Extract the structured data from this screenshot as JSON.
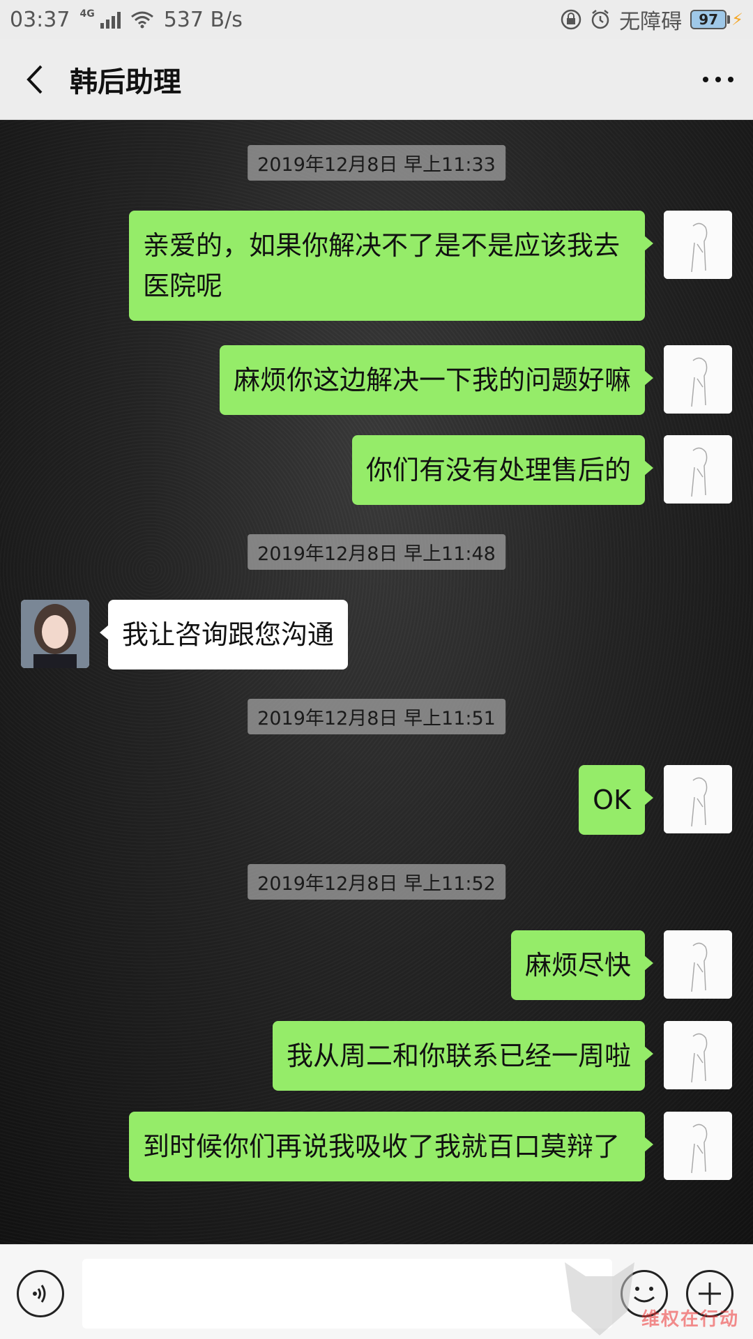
{
  "status_bar": {
    "time": "03:37",
    "network": "4G",
    "speed": "537 B/s",
    "accessibility": "无障碍",
    "battery": "97",
    "icons": [
      "signal-icon",
      "wifi-icon",
      "lock-icon",
      "alarm-icon",
      "battery-icon",
      "charging-icon"
    ]
  },
  "header": {
    "title": "韩后助理",
    "back_icon": "chevron-left-icon",
    "more_icon": "more-dots-icon"
  },
  "messages": [
    {
      "type": "timestamp",
      "text": "2019年12月8日 早上11:33"
    },
    {
      "type": "out",
      "text": "亲爱的，如果你解决不了是不是应该我去医院呢"
    },
    {
      "type": "out",
      "text": "麻烦你这边解决一下我的问题好嘛"
    },
    {
      "type": "out",
      "text": "你们有没有处理售后的"
    },
    {
      "type": "timestamp",
      "text": "2019年12月8日 早上11:48"
    },
    {
      "type": "in",
      "text": "我让咨询跟您沟通"
    },
    {
      "type": "timestamp",
      "text": "2019年12月8日 早上11:51"
    },
    {
      "type": "out",
      "text": "OK"
    },
    {
      "type": "timestamp",
      "text": "2019年12月8日 早上11:52"
    },
    {
      "type": "out",
      "text": "麻烦尽快"
    },
    {
      "type": "out",
      "text": "我从周二和你联系已经一周啦"
    },
    {
      "type": "out",
      "text": "到时候你们再说我吸收了我就百口莫辩了"
    }
  ],
  "input_bar": {
    "placeholder": "",
    "voice_icon": "voice-icon",
    "emoji_icon": "emoji-icon",
    "plus_icon": "plus-icon"
  },
  "watermark": {
    "text": "维权在行动"
  }
}
